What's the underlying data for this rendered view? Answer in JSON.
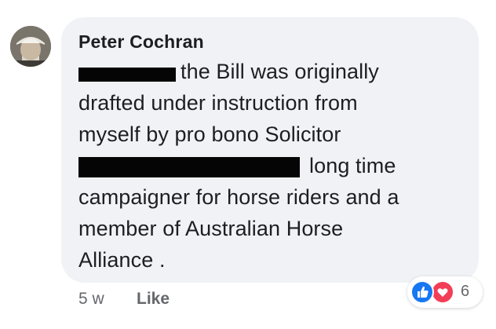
{
  "comment": {
    "author": "Peter Cochran",
    "text_lines": [
      "the Bill was originally",
      "drafted under instruction from",
      "myself by pro bono Solicitor",
      "long time",
      "campaigner for horse riders and a",
      "member of Australian Horse",
      "Alliance ."
    ],
    "timestamp": "5 w",
    "like_label": "Like",
    "reaction_count": "6"
  },
  "icons": {
    "avatar": "avatar-photo",
    "reaction_1": "like-reaction-icon",
    "reaction_2": "love-reaction-icon"
  },
  "colors": {
    "bubble_bg": "#f0f2f5",
    "text": "#1c1e21",
    "meta_text": "#65676b",
    "like_blue": "#1877f2",
    "love_red": "#f33e58",
    "redaction": "#050505"
  }
}
